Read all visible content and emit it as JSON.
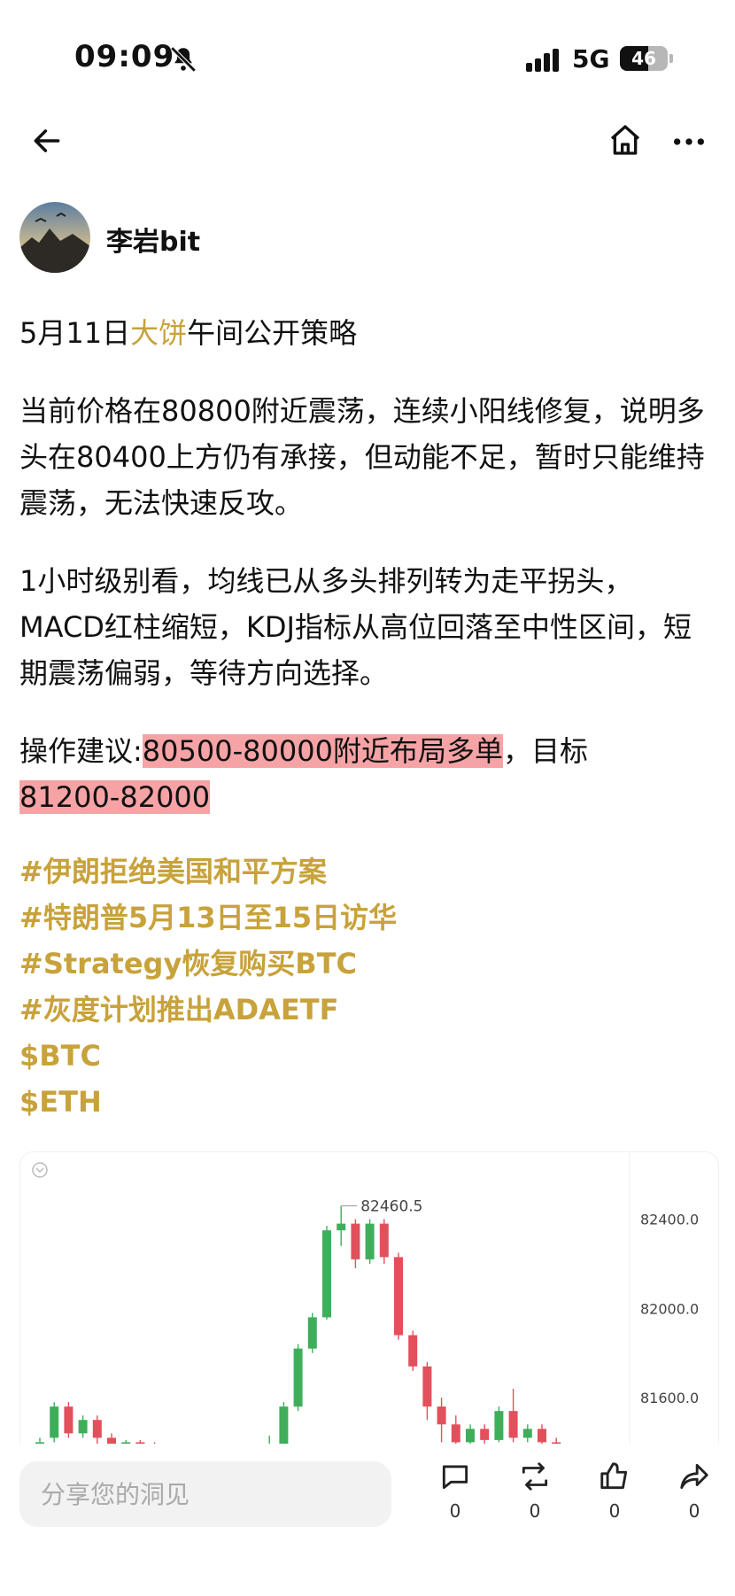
{
  "status_bar": {
    "time": "09:09",
    "network": "5G",
    "battery": "46"
  },
  "author": {
    "name": "李岩bit"
  },
  "post": {
    "title_prefix": "5月11日",
    "title_highlight": "大饼",
    "title_suffix": "午间公开策略",
    "para1": "当前价格在80800附近震荡，连续小阳线修复，说明多头在80400上方仍有承接，但动能不足，暂时只能维持震荡，无法快速反攻。",
    "para2": "1小时级别看，均线已从多头排列转为走平拐头，MACD红柱缩短，KDJ指标从高位回落至中性区间，短期震荡偏弱，等待方向选择。",
    "advice_prefix": "操作建议:",
    "advice_highlight1": "80500-80000附近布局多单",
    "advice_mid": "，目标",
    "advice_highlight2": "81200-82000",
    "tags": [
      "#伊朗拒绝美国和平方案",
      "#特朗普5月13日至15日访华",
      "#Strategy恢复购买BTC",
      "#灰度计划推出ADAETF",
      "$BTC",
      "$ETH"
    ]
  },
  "chart_data": {
    "type": "candlestick",
    "high_label": "82460.5",
    "y_ticks": [
      "82400.0",
      "82000.0",
      "81600.0"
    ],
    "y_tick_values": [
      82400,
      82000,
      81600
    ],
    "ylim": [
      81350,
      82700
    ],
    "colors": {
      "up": "#3fae5b",
      "down": "#e2505c"
    },
    "candles": [
      [
        81350,
        81400,
        81340,
        81420
      ],
      [
        81420,
        81560,
        81400,
        81580
      ],
      [
        81560,
        81440,
        81420,
        81580
      ],
      [
        81440,
        81500,
        81420,
        81520
      ],
      [
        81500,
        81420,
        81380,
        81520
      ],
      [
        81420,
        81380,
        81360,
        81440
      ],
      [
        81380,
        81400,
        81370,
        81410
      ],
      [
        81400,
        81390,
        81380,
        81410
      ],
      [
        81390,
        81380,
        81370,
        81400
      ],
      [
        81380,
        81360,
        81350,
        81390
      ],
      [
        81360,
        81380,
        81350,
        81390
      ],
      [
        81380,
        81370,
        81360,
        81390
      ],
      [
        81370,
        81360,
        81350,
        81380
      ],
      [
        81360,
        81370,
        81350,
        81380
      ],
      [
        81370,
        81360,
        81350,
        81380
      ],
      [
        81360,
        81370,
        81350,
        81380
      ],
      [
        81370,
        81390,
        81350,
        81430
      ],
      [
        81390,
        81560,
        81380,
        81580
      ],
      [
        81560,
        81820,
        81540,
        81840
      ],
      [
        81820,
        81960,
        81800,
        81980
      ],
      [
        81960,
        82350,
        81950,
        82370
      ],
      [
        82350,
        82380,
        82280,
        82460
      ],
      [
        82380,
        82220,
        82180,
        82400
      ],
      [
        82220,
        82380,
        82200,
        82400
      ],
      [
        82380,
        82230,
        82200,
        82400
      ],
      [
        82230,
        81880,
        81860,
        82250
      ],
      [
        81880,
        81740,
        81720,
        81900
      ],
      [
        81740,
        81560,
        81500,
        81760
      ],
      [
        81560,
        81480,
        81400,
        81600
      ],
      [
        81480,
        81400,
        81360,
        81520
      ],
      [
        81400,
        81460,
        81380,
        81480
      ],
      [
        81460,
        81410,
        81370,
        81480
      ],
      [
        81410,
        81540,
        81400,
        81560
      ],
      [
        81540,
        81420,
        81400,
        81640
      ],
      [
        81420,
        81460,
        81400,
        81480
      ],
      [
        81460,
        81400,
        81380,
        81480
      ],
      [
        81400,
        81360,
        81350,
        81420
      ]
    ]
  },
  "bottom_bar": {
    "share_placeholder": "分享您的洞见",
    "comment_count": "0",
    "repost_count": "0",
    "like_count": "0",
    "share_count": "0"
  }
}
